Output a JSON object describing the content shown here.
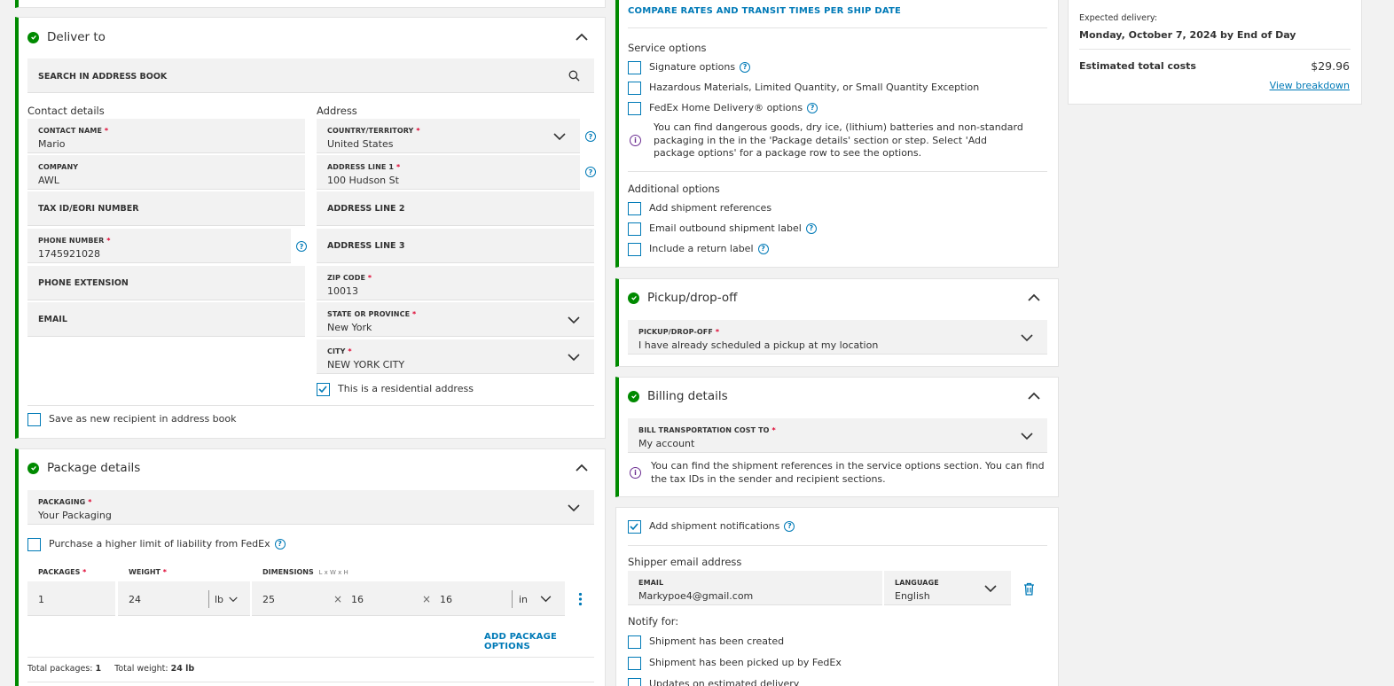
{
  "deliver_to": {
    "title": "Deliver to",
    "search_placeholder": "SEARCH IN ADDRESS BOOK",
    "contact_heading": "Contact details",
    "address_heading": "Address",
    "contact_name_label": "CONTACT NAME",
    "contact_name_value": "Mario",
    "company_label": "COMPANY",
    "company_value": "AWL",
    "tax_id_label": "TAX ID/EORI NUMBER",
    "phone_label": "PHONE NUMBER",
    "phone_value": "1745921028",
    "phone_ext_label": "PHONE EXTENSION",
    "email_label": "EMAIL",
    "country_label": "COUNTRY/TERRITORY",
    "country_value": "United States",
    "address1_label": "ADDRESS LINE 1",
    "address1_value": "100 Hudson St",
    "address2_label": "ADDRESS LINE 2",
    "address3_label": "ADDRESS LINE 3",
    "zip_label": "ZIP CODE",
    "zip_value": "10013",
    "state_label": "STATE OR PROVINCE",
    "state_value": "New York",
    "city_label": "CITY",
    "city_value": "NEW YORK CITY",
    "residential_label": "This is a residential address",
    "save_recipient_label": "Save as new recipient in address book"
  },
  "package_details": {
    "title": "Package details",
    "packaging_label": "PACKAGING",
    "packaging_value": "Your Packaging",
    "liability_label": "Purchase a higher limit of liability from FedEx",
    "packages_label": "PACKAGES",
    "weight_label": "WEIGHT",
    "dimensions_label": "DIMENSIONS",
    "dimensions_hint": "L x W x H",
    "packages_value": "1",
    "weight_value": "24",
    "weight_unit": "lb",
    "dim_l": "25",
    "dim_w": "16",
    "dim_h": "16",
    "dim_unit": "in",
    "times_sign": "×",
    "add_options": "ADD PACKAGE OPTIONS",
    "total_packages_label": "Total packages:",
    "total_packages_value": "1",
    "total_weight_label": "Total weight:",
    "total_weight_value": "24 lb"
  },
  "service": {
    "compare_link": "COMPARE RATES AND TRANSIT TIMES PER SHIP DATE",
    "service_options_heading": "Service options",
    "signature_label": "Signature options",
    "hazmat_label": "Hazardous Materials, Limited Quantity, or Small Quantity Exception",
    "home_delivery_label": "FedEx Home Delivery® options",
    "info_text": "You can find dangerous goods, dry ice, (lithium) batteries and non-standard packaging in the in the 'Package details' section or step. Select 'Add package options' for a package row to see the options.",
    "additional_heading": "Additional options",
    "references_label": "Add shipment references",
    "email_label_label": "Email outbound shipment label",
    "return_label": "Include a return label"
  },
  "pickup": {
    "title": "Pickup/drop-off",
    "field_label": "PICKUP/DROP-OFF",
    "field_value": "I have already scheduled a pickup at my location"
  },
  "billing": {
    "title": "Billing details",
    "field_label": "BILL TRANSPORTATION COST TO",
    "field_value": "My account",
    "info_text": "You can find the shipment references in the service options section. You can find the tax IDs in the sender and recipient sections."
  },
  "notifications": {
    "add_label": "Add shipment notifications",
    "shipper_heading": "Shipper email address",
    "email_label": "EMAIL",
    "email_value": "Markypoe4@gmail.com",
    "language_label": "LANGUAGE",
    "language_value": "English",
    "notify_heading": "Notify for:",
    "created_label": "Shipment has been created",
    "picked_label": "Shipment has been picked up by FedEx",
    "updates_label": "Updates on estimated delivery"
  },
  "summary": {
    "expected_label": "Expected delivery:",
    "expected_value": "Monday, October 7, 2024 by End of Day",
    "total_label": "Estimated total costs",
    "total_value": "$29.96",
    "breakdown_link": "View breakdown"
  },
  "colors": {
    "accent": "#007ab7",
    "success": "#008a00",
    "required": "#de002e",
    "info": "#6b2d91"
  }
}
